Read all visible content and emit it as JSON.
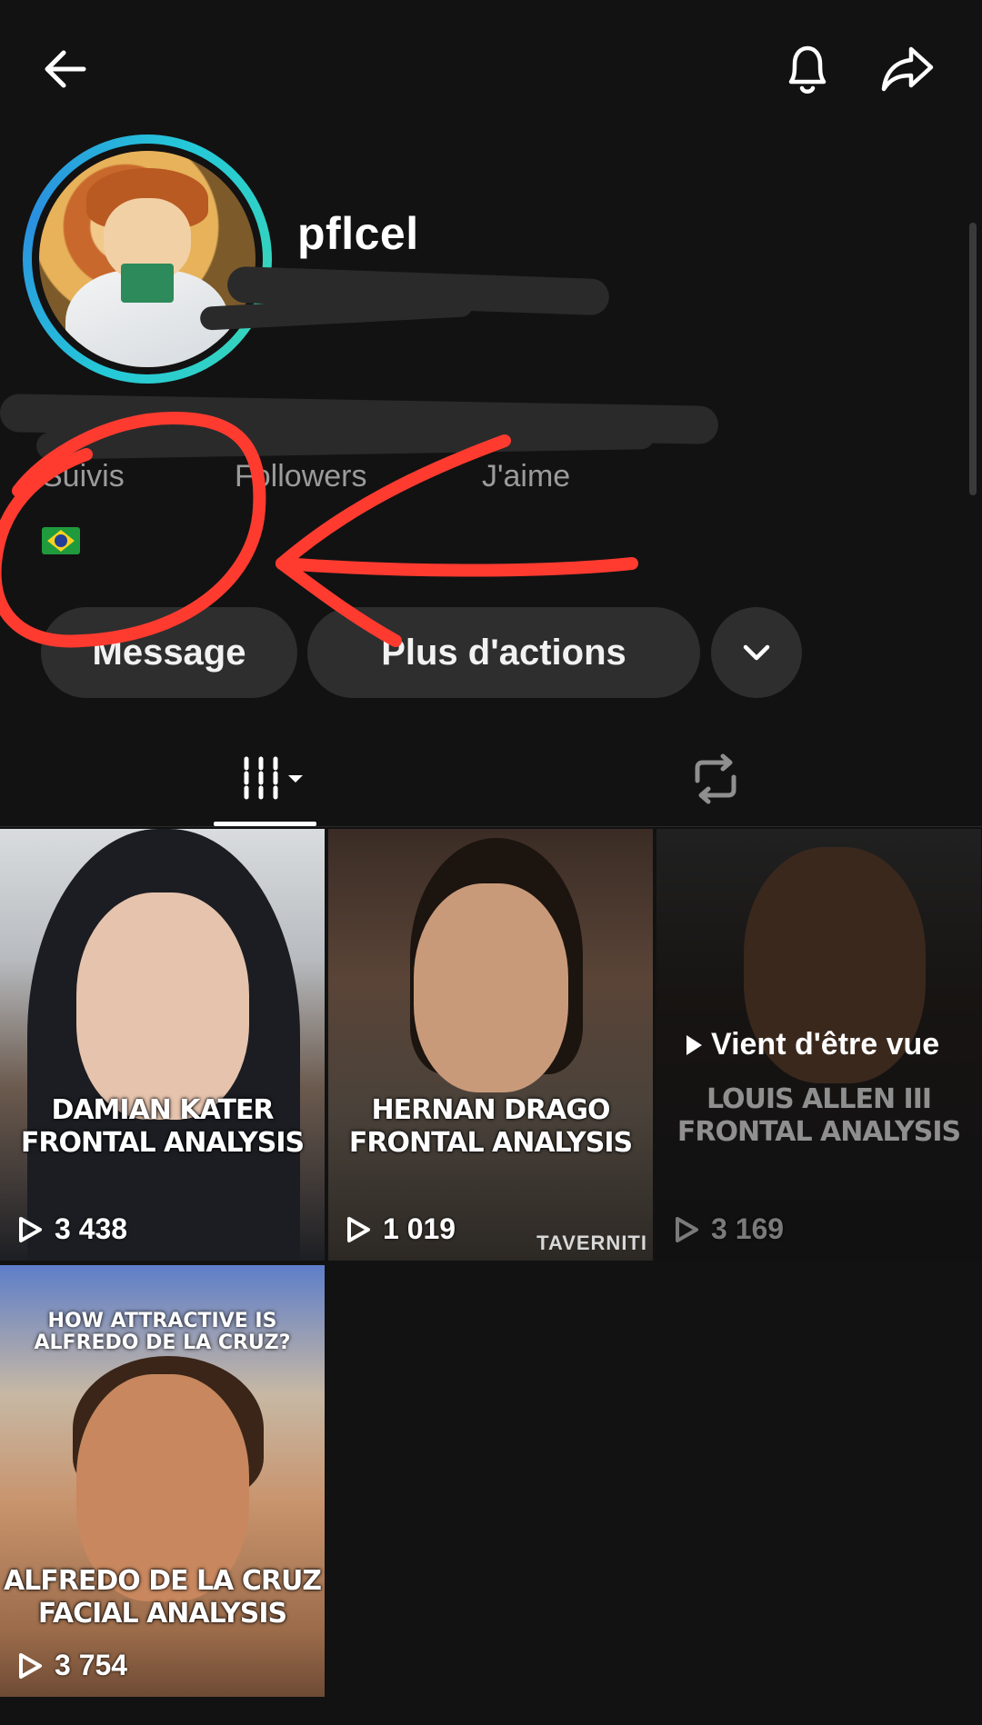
{
  "header": {
    "back_icon": "arrow-left-icon",
    "bell_icon": "bell-icon",
    "share_icon": "share-arrow-icon"
  },
  "profile": {
    "username": "pflcel",
    "stats": {
      "following_label": "Suivis",
      "followers_label": "Followers",
      "likes_label": "J'aime"
    },
    "flag_icon": "brazil-flag-icon"
  },
  "actions": {
    "message_label": "Message",
    "more_label": "Plus d'actions",
    "chevron_icon": "chevron-down-icon"
  },
  "tabs": {
    "videos_icon": "grid-icon",
    "reposts_icon": "repost-icon"
  },
  "videos": [
    {
      "title": "DAMIAN KATER FRONTAL ANALYSIS",
      "views": "3 438"
    },
    {
      "title": "HERNAN DRAGO FRONTAL ANALYSIS",
      "views": "1 019",
      "watermark": "TAVERNITI"
    },
    {
      "title": "LOUIS ALLEN III FRONTAL ANALYSIS",
      "views": "3 169",
      "badge": "Vient d'être vue"
    },
    {
      "subtitle": "HOW ATTRACTIVE IS ALFREDO DE LA CRUZ?",
      "title": "ALFREDO DE LA CRUZ FACIAL ANALYSIS",
      "views": "3 754"
    }
  ],
  "colors": {
    "background": "#121212",
    "button_bg": "#2e2e2e",
    "avatar_ring": "#25c9d8",
    "annotation": "#ff3b30"
  }
}
